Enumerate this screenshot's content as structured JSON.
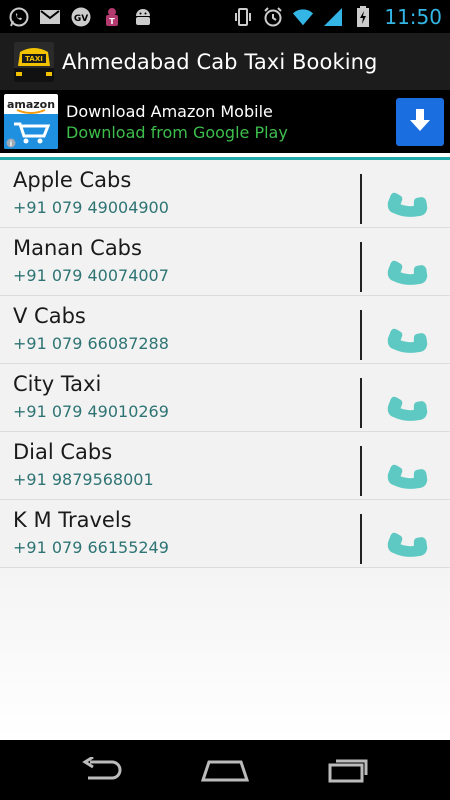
{
  "status_bar": {
    "time": "11:50",
    "left_icons": [
      "whatsapp-icon",
      "gmail-icon",
      "google-voice-icon",
      "tmobile-icon",
      "android-icon"
    ],
    "right_icons": [
      "vibrate-icon",
      "alarm-icon",
      "wifi-icon",
      "signal-icon",
      "battery-icon"
    ],
    "clock_color": "#33b5e5"
  },
  "action_bar": {
    "title": "Ahmedabad Cab Taxi Booking",
    "app_icon": "taxi-sign-icon"
  },
  "ad": {
    "logo_text": "amazon",
    "title": "Download Amazon Mobile",
    "subtitle": "Download from Google Play",
    "download_icon": "download-arrow-icon",
    "subtitle_color": "#3ebe4c",
    "button_color": "#1a6ee0"
  },
  "accent_color": "#22a9a9",
  "contacts": [
    {
      "name": "Apple Cabs",
      "phone": "+91 079 49004900"
    },
    {
      "name": "Manan Cabs",
      "phone": "+91 079 40074007"
    },
    {
      "name": "V Cabs",
      "phone": "+91 079 66087288"
    },
    {
      "name": "City Taxi",
      "phone": "+91 079 49010269"
    },
    {
      "name": "Dial Cabs",
      "phone": "+91 9879568001"
    },
    {
      "name": "K M Travels",
      "phone": "+91 079 66155249"
    }
  ],
  "nav_bar": {
    "buttons": [
      "back-icon",
      "home-icon",
      "recent-apps-icon"
    ]
  }
}
